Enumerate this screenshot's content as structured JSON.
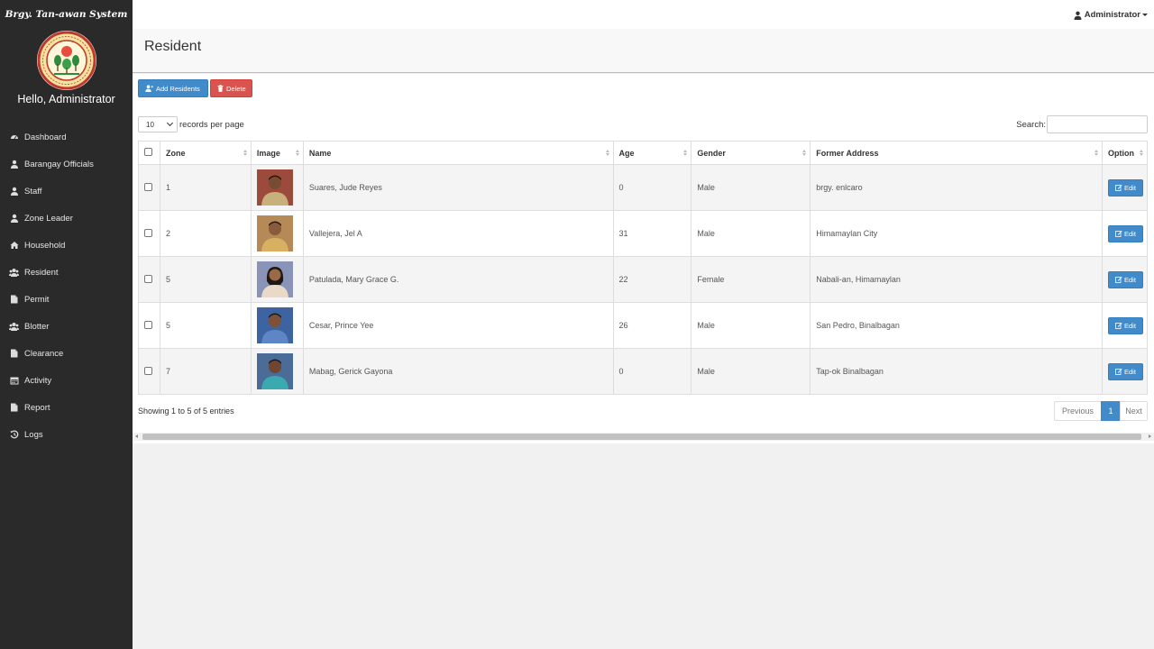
{
  "sidebar": {
    "brand": "Brgy. Tan-awan System",
    "greeting": "Hello, Administrator",
    "items": [
      {
        "label": "Dashboard",
        "icon": "dashboard-icon"
      },
      {
        "label": "Barangay Officials",
        "icon": "user-icon"
      },
      {
        "label": "Staff",
        "icon": "user-icon"
      },
      {
        "label": "Zone Leader",
        "icon": "user-icon"
      },
      {
        "label": "Household",
        "icon": "home-icon"
      },
      {
        "label": "Resident",
        "icon": "users-icon"
      },
      {
        "label": "Permit",
        "icon": "file-icon"
      },
      {
        "label": "Blotter",
        "icon": "users-icon"
      },
      {
        "label": "Clearance",
        "icon": "file-icon"
      },
      {
        "label": "Activity",
        "icon": "calendar-icon"
      },
      {
        "label": "Report",
        "icon": "file-icon"
      },
      {
        "label": "Logs",
        "icon": "history-icon"
      }
    ]
  },
  "topbar": {
    "user_label": "Administrator"
  },
  "page": {
    "title": "Resident"
  },
  "toolbar": {
    "add_label": "Add Residents",
    "delete_label": "Delete"
  },
  "table_controls": {
    "page_length": "10",
    "length_suffix": "records per page",
    "search_label": "Search:",
    "search_value": ""
  },
  "table": {
    "columns": [
      "Zone",
      "Image",
      "Name",
      "Age",
      "Gender",
      "Former Address",
      "Option"
    ],
    "rows": [
      {
        "zone": "1",
        "name": "Suares, Jude Reyes",
        "age": "0",
        "gender": "Male",
        "address": "brgy. enlcaro",
        "photo_bg": "#9b4a3c",
        "photo_shirt": "#c8b07a"
      },
      {
        "zone": "2",
        "name": "Vallejera, Jel A",
        "age": "31",
        "gender": "Male",
        "address": "Himamaylan City",
        "photo_bg": "#b58a56",
        "photo_shirt": "#d9b062"
      },
      {
        "zone": "5",
        "name": "Patulada, Mary Grace G.",
        "age": "22",
        "gender": "Female",
        "address": "Nabali-an, Himamaylan",
        "photo_bg": "#8a93b8",
        "photo_shirt": "#e9d9c6"
      },
      {
        "zone": "5",
        "name": "Cesar, Prince Yee",
        "age": "26",
        "gender": "Male",
        "address": "San Pedro, Binalbagan",
        "photo_bg": "#3d63a0",
        "photo_shirt": "#5e86c6"
      },
      {
        "zone": "7",
        "name": "Mabag, Gerick Gayona",
        "age": "0",
        "gender": "Male",
        "address": "Tap-ok Binalbagan",
        "photo_bg": "#4a6c96",
        "photo_shirt": "#3aa9b0"
      }
    ],
    "edit_label": "Edit"
  },
  "footer": {
    "info": "Showing 1 to 5 of 5 entries",
    "prev": "Previous",
    "current_page": "1",
    "next": "Next"
  },
  "colors": {
    "sidebar_bg": "#2a2a2a",
    "primary": "#428bca",
    "danger": "#d9534f"
  }
}
